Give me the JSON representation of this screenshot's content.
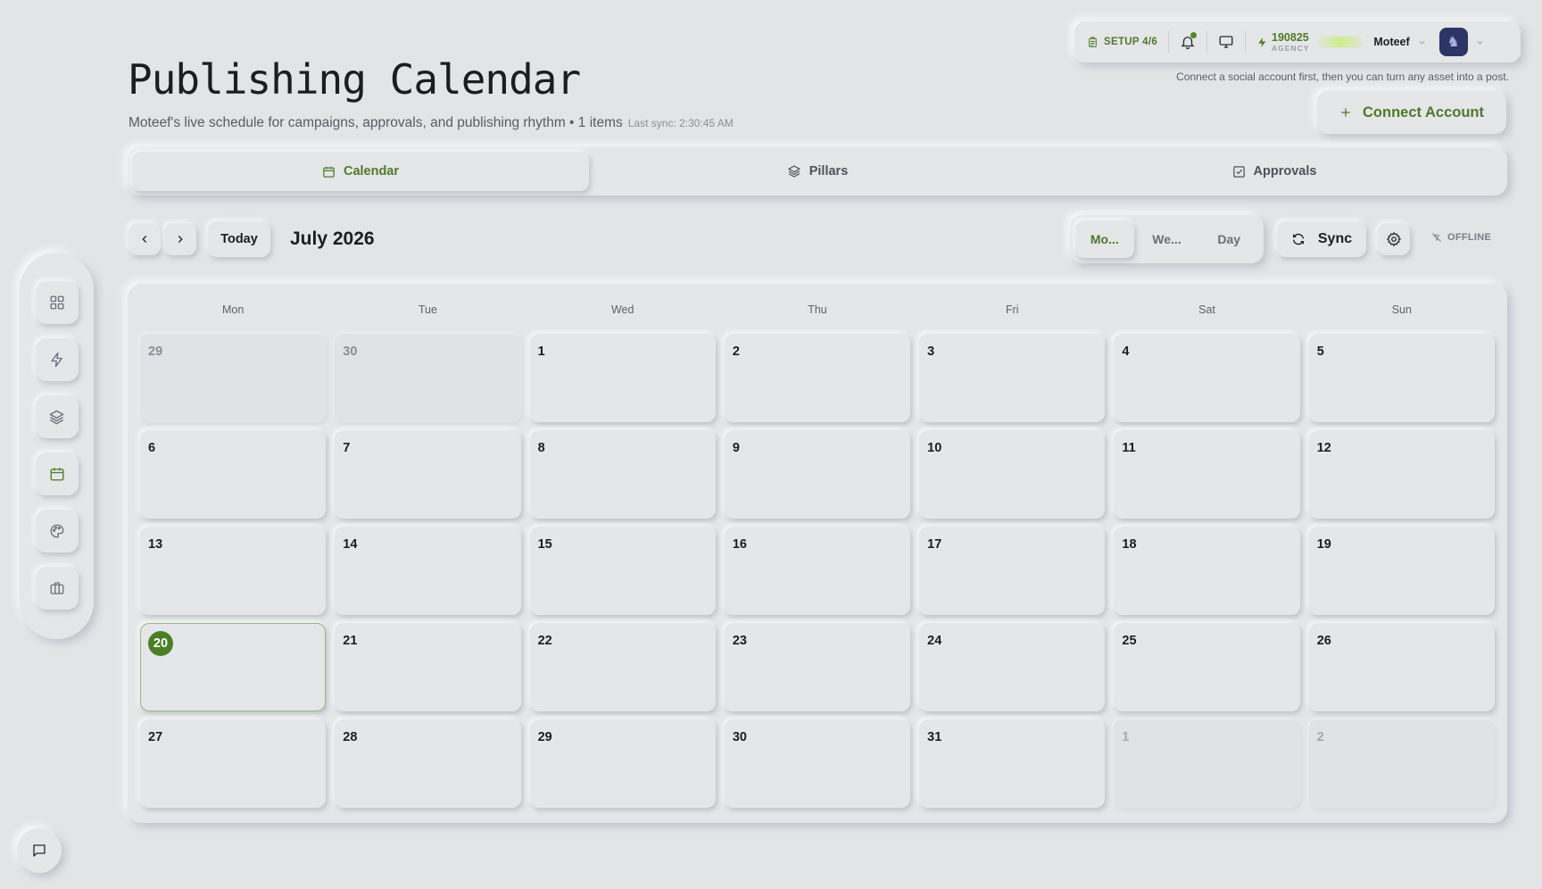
{
  "header": {
    "title": "Publishing Calendar",
    "subtitle": "Moteef's live schedule for campaigns, approvals, and publishing rhythm • 1 items",
    "last_sync": "Last sync: 2:30:45 AM"
  },
  "topbar": {
    "setup_label": "SETUP 4/6",
    "credits_value": "190825",
    "credits_label": "AGENCY",
    "user_name": "Moteef",
    "avatar_glyph": "♞",
    "connect_hint": "Connect a social account first, then you can turn any asset into a post.",
    "connect_button": "Connect Account"
  },
  "tabs": [
    {
      "label": "Calendar",
      "icon": "calendar-icon",
      "active": true
    },
    {
      "label": "Pillars",
      "icon": "layers-icon",
      "active": false
    },
    {
      "label": "Approvals",
      "icon": "check-square-icon",
      "active": false
    }
  ],
  "toolbar": {
    "today_label": "Today",
    "month_label": "July 2026",
    "views": [
      {
        "label": "Mo...",
        "active": true
      },
      {
        "label": "We...",
        "active": false
      },
      {
        "label": "Day",
        "active": false
      }
    ],
    "sync_label": "Sync",
    "offline_label": "OFFLINE"
  },
  "sidebar": {
    "items": [
      {
        "name": "dashboard",
        "icon": "grid-icon"
      },
      {
        "name": "automations",
        "icon": "lightning-icon"
      },
      {
        "name": "pillars",
        "icon": "layers-icon"
      },
      {
        "name": "calendar",
        "icon": "calendar-icon",
        "active": true
      },
      {
        "name": "brand",
        "icon": "palette-icon"
      },
      {
        "name": "portfolio",
        "icon": "briefcase-icon"
      }
    ]
  },
  "calendar": {
    "weekdays": [
      "Mon",
      "Tue",
      "Wed",
      "Thu",
      "Fri",
      "Sat",
      "Sun"
    ],
    "weeks": [
      [
        {
          "d": "29",
          "m": "prev"
        },
        {
          "d": "30",
          "m": "prev"
        },
        {
          "d": "1"
        },
        {
          "d": "2"
        },
        {
          "d": "3"
        },
        {
          "d": "4"
        },
        {
          "d": "5"
        }
      ],
      [
        {
          "d": "6"
        },
        {
          "d": "7"
        },
        {
          "d": "8"
        },
        {
          "d": "9"
        },
        {
          "d": "10"
        },
        {
          "d": "11"
        },
        {
          "d": "12"
        }
      ],
      [
        {
          "d": "13"
        },
        {
          "d": "14"
        },
        {
          "d": "15"
        },
        {
          "d": "16"
        },
        {
          "d": "17"
        },
        {
          "d": "18"
        },
        {
          "d": "19"
        }
      ],
      [
        {
          "d": "20",
          "today": true
        },
        {
          "d": "21"
        },
        {
          "d": "22"
        },
        {
          "d": "23"
        },
        {
          "d": "24"
        },
        {
          "d": "25"
        },
        {
          "d": "26"
        }
      ],
      [
        {
          "d": "27"
        },
        {
          "d": "28"
        },
        {
          "d": "29"
        },
        {
          "d": "30"
        },
        {
          "d": "31"
        },
        {
          "d": "1",
          "m": "next"
        },
        {
          "d": "2",
          "m": "next"
        }
      ]
    ]
  },
  "colors": {
    "accent": "#4f7a2a",
    "today_badge": "#4a7f26",
    "background": "#e2e4e6",
    "avatar_bg": "#2c3566"
  }
}
